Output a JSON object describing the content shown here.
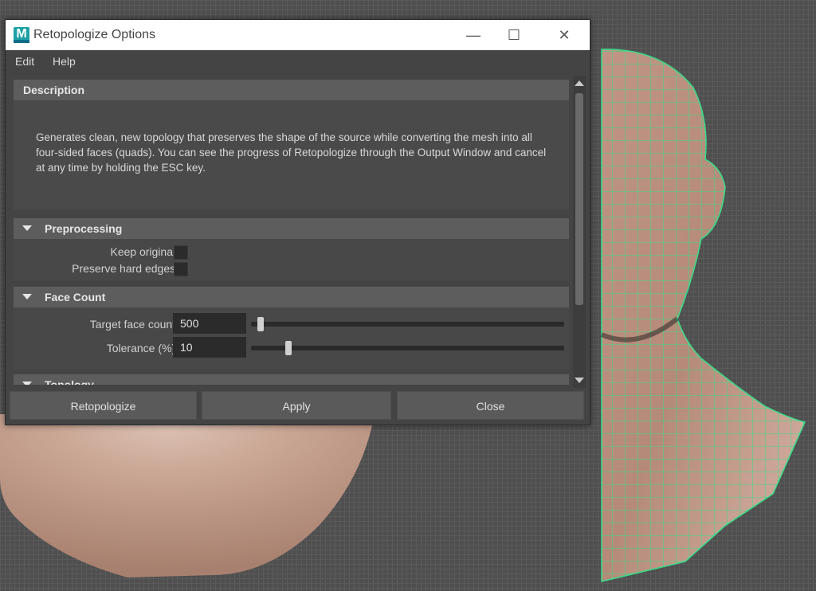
{
  "window": {
    "title": "Retopologize Options",
    "app_icon_letter": "M",
    "minimize_glyph": "—",
    "maximize_glyph": "☐",
    "close_glyph": "✕"
  },
  "menu": {
    "items": [
      "Edit",
      "Help"
    ]
  },
  "description": {
    "header": "Description",
    "text": "Generates clean, new topology that preserves the shape of the source while converting the mesh into all four-sided faces (quads). You can see the progress of Retopologize through the Output Window and cancel at any time by holding the ESC key."
  },
  "preprocessing": {
    "header": "Preprocessing",
    "keep_original_label": "Keep original:",
    "keep_original_checked": false,
    "preserve_hard_edges_label": "Preserve hard edges:",
    "preserve_hard_edges_checked": false
  },
  "face_count": {
    "header": "Face Count",
    "target_label": "Target face count:",
    "target_value": "500",
    "target_slider_fraction": 0.01,
    "tolerance_label": "Tolerance (%):",
    "tolerance_value": "10",
    "tolerance_slider_fraction": 0.1
  },
  "topology": {
    "header": "Topology"
  },
  "buttons": {
    "retopologize": "Retopologize",
    "apply": "Apply",
    "close": "Close"
  },
  "colors": {
    "wireframe": "#33e08a",
    "skin": "#c9a08f",
    "panel": "#444444",
    "section_header": "#5d5d5d"
  },
  "icons": [
    "maya-app-icon",
    "minimize-icon",
    "maximize-icon",
    "close-icon",
    "collapse-triangle-icon",
    "scroll-up-icon",
    "scroll-down-icon"
  ]
}
